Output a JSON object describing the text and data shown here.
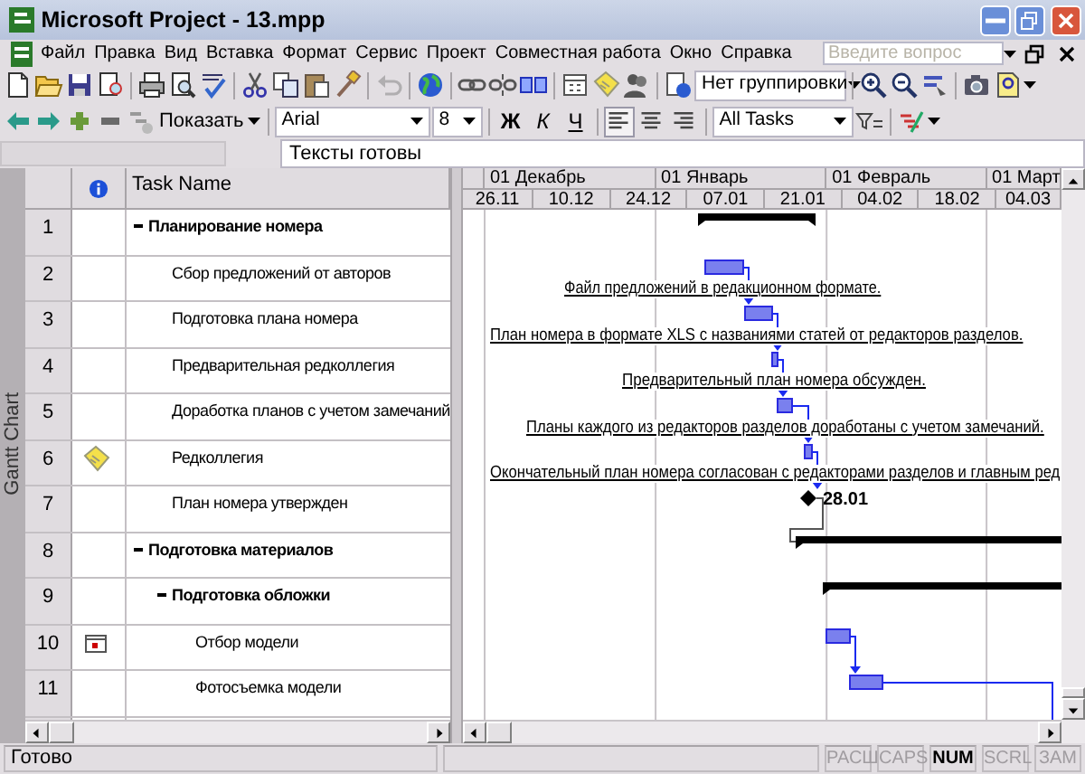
{
  "window": {
    "title": "Microsoft Project - 13.mpp"
  },
  "menu": [
    {
      "label": "Файл"
    },
    {
      "label": "Правка"
    },
    {
      "label": "Вид"
    },
    {
      "label": "Вставка"
    },
    {
      "label": "Формат"
    },
    {
      "label": "Сервис"
    },
    {
      "label": "Проект"
    },
    {
      "label": "Совместная работа"
    },
    {
      "label": "Окно"
    },
    {
      "label": "Справка"
    }
  ],
  "help_search": {
    "placeholder": "Введите вопрос"
  },
  "standard_toolbar": {
    "grouping": "Нет группировки"
  },
  "formatting_toolbar": {
    "show_button": "Показать",
    "font": "Arial",
    "size": "8",
    "styles": [
      {
        "label": "Ж"
      },
      {
        "label": "К"
      },
      {
        "label": "Ч"
      }
    ],
    "alignment": [
      {
        "selected": true
      },
      {
        "selected": false
      },
      {
        "selected": false
      }
    ],
    "filter": "All Tasks"
  },
  "entry_bar": {
    "value": "Тексты готовы"
  },
  "view_bar": {
    "label": "Gantt Chart"
  },
  "table": {
    "task_name_column": "Task Name"
  },
  "tasks": [
    {
      "id": "1",
      "name": "Планирование номера",
      "kind": "summary",
      "expanded": true,
      "children": [
        {
          "id": "2",
          "name": "Сбор предложений от авторов",
          "kind": "task",
          "gantt_label": "Файл предложений в редакционном формате."
        },
        {
          "id": "3",
          "name": "Подготовка плана номера",
          "kind": "task",
          "gantt_label": "План номера в формате XLS с названиями статей от редакторов разделов."
        },
        {
          "id": "4",
          "name": "Предварительная редколлегия",
          "kind": "task",
          "gantt_label": "Предварительный план номера обсужден."
        },
        {
          "id": "5",
          "name": "Доработка планов с учетом замечаний",
          "kind": "task",
          "gantt_label": "Планы каждого из редакторов разделов доработаны с учетом замечаний."
        },
        {
          "id": "6",
          "name": "Редколлегия",
          "kind": "task",
          "note": true,
          "gantt_label": "Окончательный план номера согласован с редакторами разделов и главным ред"
        },
        {
          "id": "7",
          "name": "План номера утвержден",
          "kind": "milestone",
          "gantt_date": "28.01"
        }
      ]
    },
    {
      "id": "8",
      "name": "Подготовка материалов",
      "kind": "summary",
      "expanded": true,
      "children": [
        {
          "id": "9",
          "name": "Подготовка обложки",
          "kind": "summary",
          "expanded": true,
          "children": [
            {
              "id": "10",
              "name": "Отбор модели",
              "kind": "task",
              "calendar": true
            },
            {
              "id": "11",
              "name": "Фотосъемка модели",
              "kind": "task"
            }
          ]
        }
      ]
    }
  ],
  "timescale": {
    "major": [
      "01 Декабрь",
      "01 Январь",
      "01 Февраль",
      "01 Март"
    ],
    "minor": [
      "26.11",
      "10.12",
      "24.12",
      "07.01",
      "21.01",
      "04.02",
      "18.02",
      "04.03"
    ]
  },
  "status_bar": {
    "text": "Готово",
    "indicators": [
      {
        "label": "РАСШ",
        "on": false
      },
      {
        "label": "CAPS",
        "on": false
      },
      {
        "label": "NUM",
        "on": true
      },
      {
        "label": "SCRL",
        "on": false
      },
      {
        "label": "ЗАМ",
        "on": false
      }
    ]
  }
}
